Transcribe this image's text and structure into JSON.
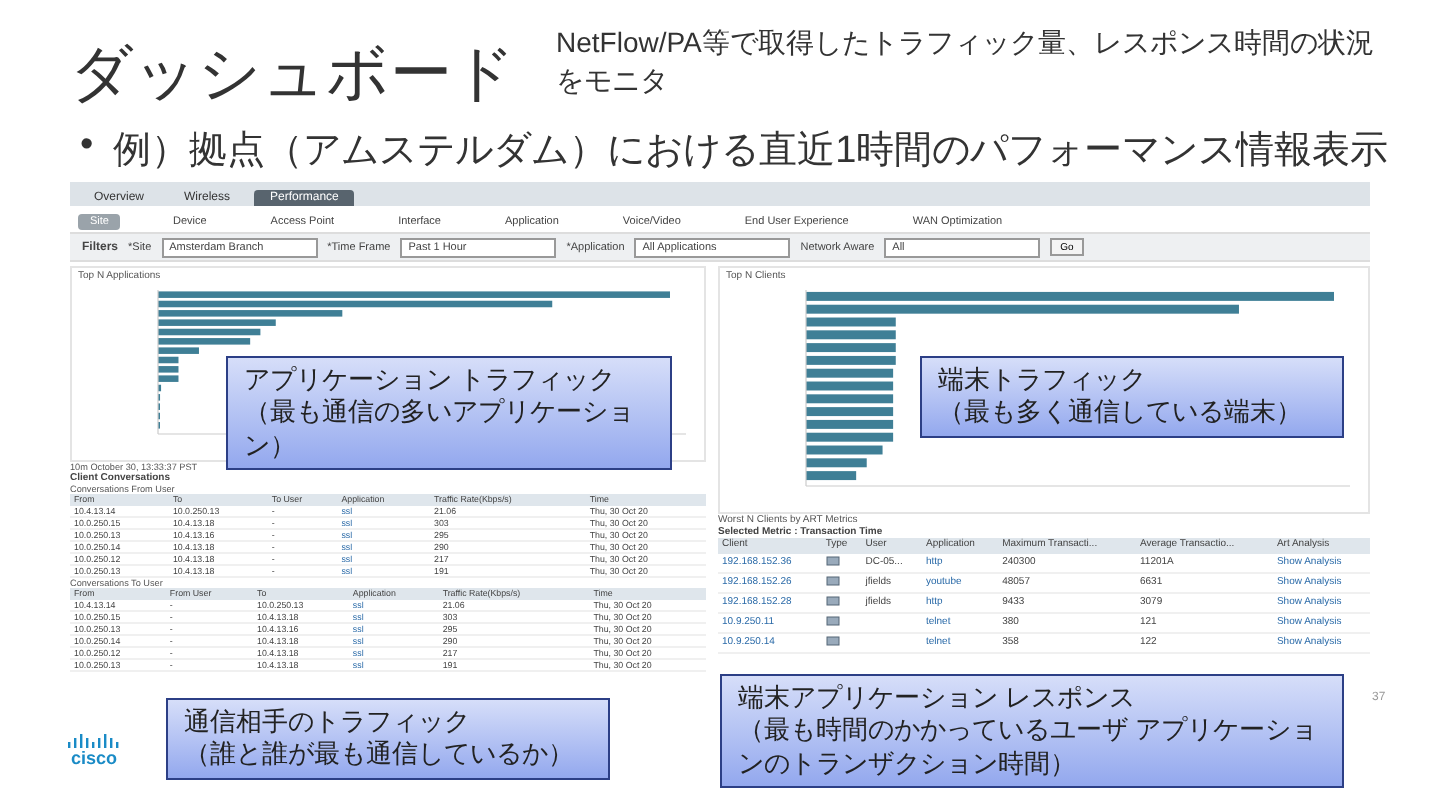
{
  "slide": {
    "title": "ダッシュボード",
    "subtitle": "NetFlow/PA等で取得したトラフィック量、レスポンス時間の状況をモニタ",
    "bullet": "•",
    "bullet_text": "例）拠点（アムステルダム）における直近1時間のパフォーマンス情報表示",
    "logo": "cisco",
    "page_number": "37"
  },
  "screen": {
    "tabs": [
      {
        "label": "Overview",
        "selected": false
      },
      {
        "label": "Wireless",
        "selected": false
      },
      {
        "label": "Performance",
        "selected": true
      }
    ],
    "subtabs": [
      {
        "label": "Site",
        "selected": true
      },
      {
        "label": "Device",
        "selected": false
      },
      {
        "label": "Access Point",
        "selected": false
      },
      {
        "label": "Interface",
        "selected": false
      },
      {
        "label": "Application",
        "selected": false
      },
      {
        "label": "Voice/Video",
        "selected": false
      },
      {
        "label": "End User Experience",
        "selected": false
      },
      {
        "label": "WAN Optimization",
        "selected": false
      }
    ],
    "filters": {
      "label": "Filters",
      "fields": [
        {
          "label": "*Site",
          "value": "Amsterdam Branch"
        },
        {
          "label": "*Time Frame",
          "value": "Past 1 Hour"
        },
        {
          "label": "*Application",
          "value": "All Applications"
        },
        {
          "label": "Network Aware",
          "value": "All"
        }
      ],
      "button": "Go"
    },
    "left_chart": {
      "title": "Top N Applications"
    },
    "right_chart": {
      "title": "Top N Clients"
    },
    "timestamp": "10m  October 30, 13:33:37 PST",
    "conversations": {
      "title": "Client Conversations",
      "tables": [
        {
          "title": "Conversations From User",
          "columns": [
            {
              "label": "From"
            },
            {
              "label": "To"
            },
            {
              "label": "To User"
            },
            {
              "label": "Application",
              "kind": "link"
            },
            {
              "label": "Traffic Rate(Kbps/s)"
            },
            {
              "label": "Time"
            }
          ],
          "rows": [
            [
              "10.4.13.14",
              "10.0.250.13",
              "-",
              "ssl",
              "21.06",
              "Thu, 30 Oct 20"
            ],
            [
              "10.0.250.15",
              "10.4.13.18",
              "-",
              "ssl",
              "303",
              "Thu, 30 Oct 20"
            ],
            [
              "10.0.250.13",
              "10.4.13.16",
              "-",
              "ssl",
              "295",
              "Thu, 30 Oct 20"
            ],
            [
              "10.0.250.14",
              "10.4.13.18",
              "-",
              "ssl",
              "290",
              "Thu, 30 Oct 20"
            ],
            [
              "10.0.250.12",
              "10.4.13.18",
              "-",
              "ssl",
              "217",
              "Thu, 30 Oct 20"
            ],
            [
              "10.0.250.13",
              "10.4.13.18",
              "-",
              "ssl",
              "191",
              "Thu, 30 Oct 20"
            ]
          ]
        },
        {
          "title": "Conversations To User",
          "columns": [
            {
              "label": "From"
            },
            {
              "label": "From User"
            },
            {
              "label": "To"
            },
            {
              "label": "Application",
              "kind": "link"
            },
            {
              "label": "Traffic Rate(Kbps/s)"
            },
            {
              "label": "Time"
            }
          ],
          "rows": [
            [
              "10.4.13.14",
              "-",
              "10.0.250.13",
              "ssl",
              "21.06",
              "Thu, 30 Oct 20"
            ],
            [
              "10.0.250.15",
              "-",
              "10.4.13.18",
              "ssl",
              "303",
              "Thu, 30 Oct 20"
            ],
            [
              "10.0.250.13",
              "-",
              "10.4.13.16",
              "ssl",
              "295",
              "Thu, 30 Oct 20"
            ],
            [
              "10.0.250.14",
              "-",
              "10.4.13.18",
              "ssl",
              "290",
              "Thu, 30 Oct 20"
            ],
            [
              "10.0.250.12",
              "-",
              "10.4.13.18",
              "ssl",
              "217",
              "Thu, 30 Oct 20"
            ],
            [
              "10.0.250.13",
              "-",
              "10.4.13.18",
              "ssl",
              "191",
              "Thu, 30 Oct 20"
            ]
          ]
        }
      ]
    },
    "worst": {
      "title": "Worst N Clients by ART Metrics",
      "metric": "Selected Metric : Transaction Time",
      "columns": [
        {
          "label": "Client",
          "kind": "link"
        },
        {
          "label": "Type",
          "kind": "icon"
        },
        {
          "label": "User"
        },
        {
          "label": "Application",
          "kind": "link"
        },
        {
          "label": "Maximum Transacti..."
        },
        {
          "label": "Average Transactio..."
        },
        {
          "label": "Art Analysis",
          "kind": "link"
        }
      ],
      "rows": [
        [
          "192.168.152.36",
          "",
          "DC-05...",
          "http",
          "240300",
          "11201A",
          "Show Analysis"
        ],
        [
          "192.168.152.26",
          "",
          "jfields",
          "youtube",
          "48057",
          "6631",
          "Show Analysis"
        ],
        [
          "192.168.152.28",
          "",
          "jfields",
          "http",
          "9433",
          "3079",
          "Show Analysis"
        ],
        [
          "10.9.250.11",
          "",
          "",
          "telnet",
          "380",
          "121",
          "Show Analysis"
        ],
        [
          "10.9.250.14",
          "",
          "",
          "telnet",
          "358",
          "122",
          "Show Analysis"
        ]
      ]
    }
  },
  "callouts": [
    {
      "heading": "アプリケーション トラフィック",
      "text": "（最も通信の多いアプリケーション）"
    },
    {
      "heading": "端末トラフィック",
      "text": "（最も多く通信している端末）"
    },
    {
      "heading": "通信相手のトラフィック",
      "text": "（誰と誰が最も通信しているか）"
    },
    {
      "heading": "端末アプリケーション レスポンス",
      "text": "（最も時間のかかっているユーザ アプリケーションのトランザクション時間）"
    }
  ]
}
